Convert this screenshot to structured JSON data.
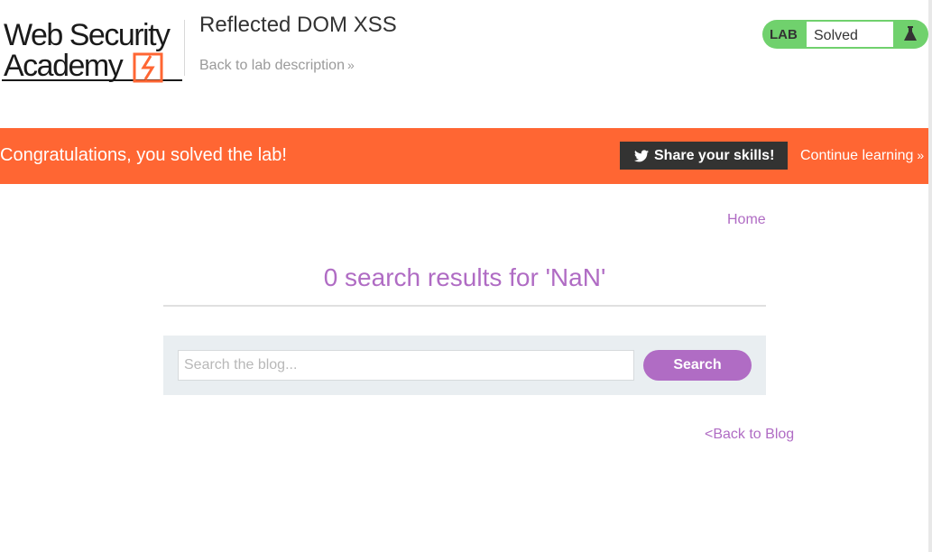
{
  "header": {
    "logo_line1": "Web Security",
    "logo_line2": "Academy",
    "lab_title": "Reflected DOM XSS",
    "back_to_description": "Back to lab description"
  },
  "status": {
    "lab_label": "LAB",
    "state": "Solved",
    "icon": "flask-icon",
    "color": "#70d16d"
  },
  "banner": {
    "message": "Congratulations, you solved the lab!",
    "share_label": "Share your skills!",
    "share_icon": "twitter-icon",
    "continue_label": "Continue learning",
    "color": "#ff6633"
  },
  "nav": {
    "home": "Home"
  },
  "main": {
    "results_heading": "0 search results for 'NaN'",
    "search_placeholder": "Search the blog...",
    "search_value": "",
    "search_button": "Search",
    "back_to_blog": "<Back to Blog",
    "accent": "#b06cc4"
  }
}
